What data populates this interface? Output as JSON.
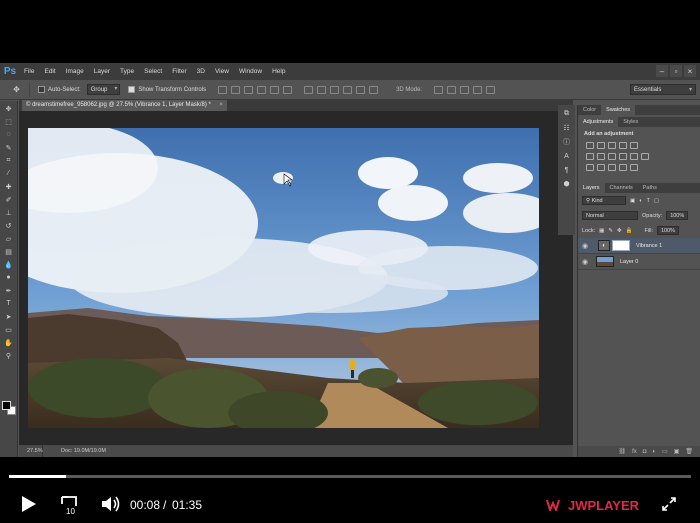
{
  "app": {
    "logo": "Ps",
    "menu": [
      "File",
      "Edit",
      "Image",
      "Layer",
      "Type",
      "Select",
      "Filter",
      "3D",
      "View",
      "Window",
      "Help"
    ],
    "window_controls": [
      "–",
      "▫",
      "×"
    ]
  },
  "options_bar": {
    "auto_select_label": "Auto-Select:",
    "auto_select_value": "Group",
    "transform_label": "Show Transform Controls",
    "mode_3d": "3D Mode:",
    "workspace": "Essentials"
  },
  "document": {
    "tab_title": "© dreamstimefree_958062.jpg @ 27.5% (Vibrance 1, Layer Mask/8) *",
    "tab_close": "×",
    "zoom": "27.5%",
    "doc_info": "Doc: 19.0M/19.0M"
  },
  "panels": {
    "color_tabs": [
      "Color",
      "Swatches"
    ],
    "adjust_tabs": [
      "Adjustments",
      "Styles"
    ],
    "adjust_title": "Add an adjustment",
    "layers_tabs": [
      "Layers",
      "Channels",
      "Paths"
    ],
    "kind": "Kind",
    "blend_mode": "Normal",
    "opacity_label": "Opacity:",
    "opacity_value": "100%",
    "lock_label": "Lock:",
    "fill_label": "Fill:",
    "fill_value": "100%",
    "layers": [
      {
        "name": "Vibrance 1",
        "selected": true
      },
      {
        "name": "Layer 0",
        "selected": false
      }
    ]
  },
  "player": {
    "current_time": "00:08",
    "separator": "/",
    "duration": "01:35",
    "rewind_seconds": "10",
    "brand_jw": "JW",
    "brand_player": "PLAYER",
    "progress_fraction": 0.084
  },
  "colors": {
    "accent": "#e0294a",
    "ps_blue": "#3fa9f5"
  }
}
